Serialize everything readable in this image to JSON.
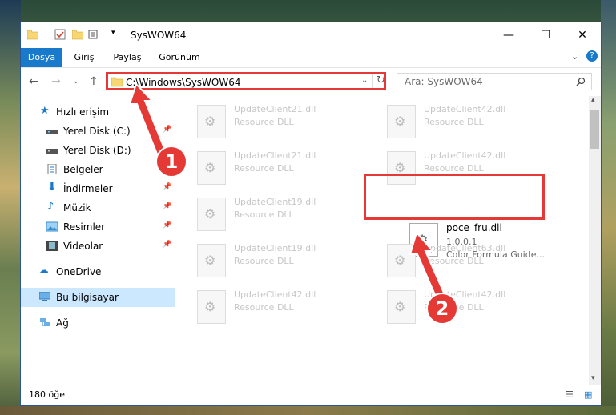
{
  "window": {
    "title": "SysWOW64",
    "accent": "#1979ca"
  },
  "tabs": [
    "Dosya",
    "Giriş",
    "Paylaş",
    "Görünüm"
  ],
  "address": {
    "path": "C:\\Windows\\SysWOW64"
  },
  "search": {
    "placeholder": "Ara: SysWOW64"
  },
  "nav": {
    "quick_access": "Hızlı erişim",
    "items": [
      "Yerel Disk (C:)",
      "Yerel Disk (D:)",
      "Belgeler",
      "İndirmeler",
      "Müzik",
      "Resimler",
      "Videolar"
    ],
    "onedrive": "OneDrive",
    "this_pc": "Bu bilgisayar",
    "network": "Ağ"
  },
  "files": [
    {
      "name": "UpdateClient21.dll",
      "desc": "Resource DLL"
    },
    {
      "name": "UpdateClient42.dll",
      "desc": "Resource DLL"
    },
    {
      "name": "UpdateClient21.dll",
      "desc": "Resource DLL"
    },
    {
      "name": "UpdateClient42.dll",
      "desc": "Resource DLL"
    },
    {
      "name": "UpdateClient19.dll",
      "desc": "Resource DLL"
    },
    {
      "name": "poce_fru.dll",
      "version": "1.0.0.1",
      "desc": "Color Formula Guide..."
    },
    {
      "name": "UpdateClient19.dll",
      "desc": "Resource DLL"
    },
    {
      "name": "UpdateClient63.dll",
      "desc": "Resource DLL"
    },
    {
      "name": "UpdateClient42.dll",
      "desc": "Resource DLL"
    },
    {
      "name": "UpdateClient42.dll",
      "desc": "Resource DLL"
    }
  ],
  "status": {
    "count": "180 öğe"
  },
  "annotations": {
    "one": "1",
    "two": "2",
    "color": "#e53935"
  }
}
